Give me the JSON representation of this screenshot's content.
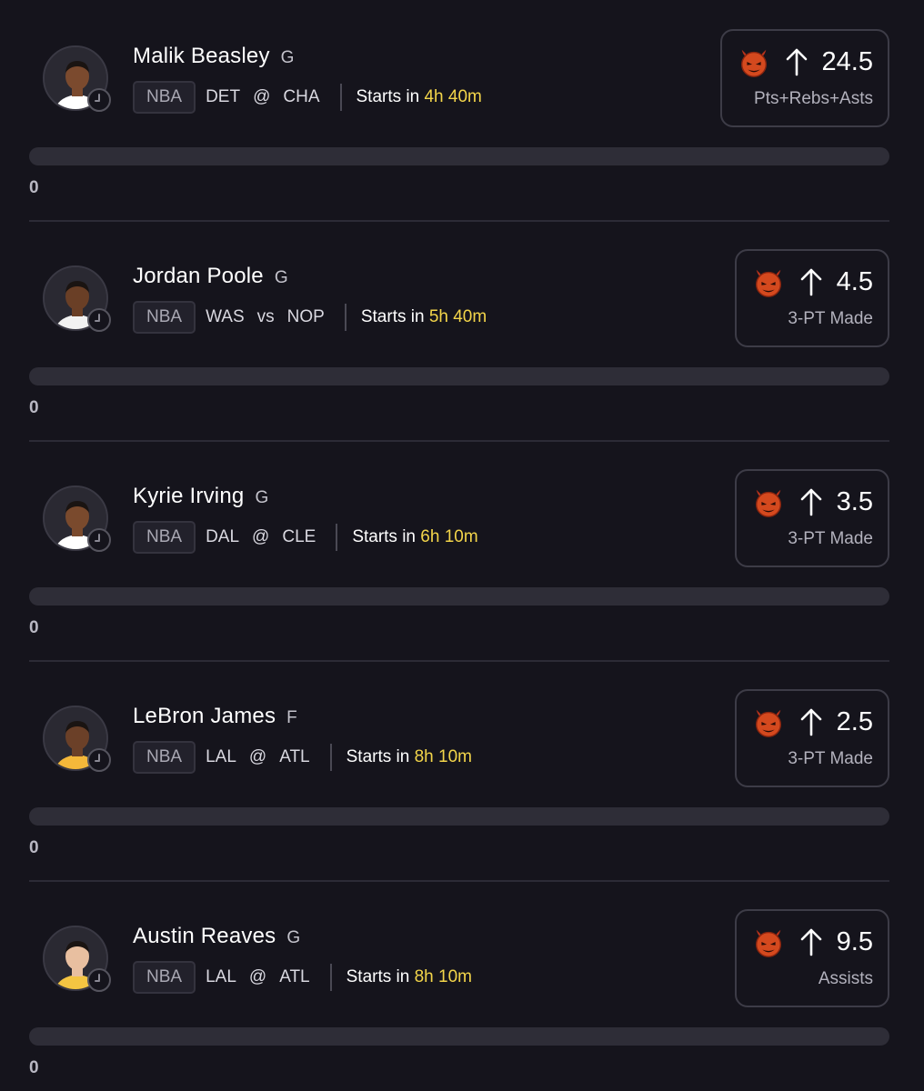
{
  "colors": {
    "background": "#15141c",
    "accent_time": "#f3d54a",
    "track": "#2e2d37",
    "devil": "#d43a1e"
  },
  "icons": {
    "multiplier": "devil-icon",
    "direction": "arrow-up-icon",
    "status": "clock-icon"
  },
  "cards": [
    {
      "name": "Malik Beasley",
      "position": "G",
      "league": "NBA",
      "team": "DET",
      "vs": "@",
      "opponent": "CHA",
      "starts_label": "Starts in",
      "starts_time": "4h 40m",
      "line": "24.5",
      "stat": "Pts+Rebs+Asts",
      "progress_value": "0",
      "progress_fraction": 0,
      "skin": "#7b4a2e",
      "jersey": "#ffffff"
    },
    {
      "name": "Jordan Poole",
      "position": "G",
      "league": "NBA",
      "team": "WAS",
      "vs": "vs",
      "opponent": "NOP",
      "starts_label": "Starts in",
      "starts_time": "5h 40m",
      "line": "4.5",
      "stat": "3-PT Made",
      "progress_value": "0",
      "progress_fraction": 0,
      "skin": "#6a3f26",
      "jersey": "#f2f2f2"
    },
    {
      "name": "Kyrie Irving",
      "position": "G",
      "league": "NBA",
      "team": "DAL",
      "vs": "@",
      "opponent": "CLE",
      "starts_label": "Starts in",
      "starts_time": "6h 10m",
      "line": "3.5",
      "stat": "3-PT Made",
      "progress_value": "0",
      "progress_fraction": 0,
      "skin": "#7a4a2d",
      "jersey": "#ffffff"
    },
    {
      "name": "LeBron James",
      "position": "F",
      "league": "NBA",
      "team": "LAL",
      "vs": "@",
      "opponent": "ATL",
      "starts_label": "Starts in",
      "starts_time": "8h 10m",
      "line": "2.5",
      "stat": "3-PT Made",
      "progress_value": "0",
      "progress_fraction": 0,
      "skin": "#6b4028",
      "jersey": "#f4b83a"
    },
    {
      "name": "Austin Reaves",
      "position": "G",
      "league": "NBA",
      "team": "LAL",
      "vs": "@",
      "opponent": "ATL",
      "starts_label": "Starts in",
      "starts_time": "8h 10m",
      "line": "9.5",
      "stat": "Assists",
      "progress_value": "0",
      "progress_fraction": 0,
      "skin": "#e8bfa0",
      "jersey": "#f4c542"
    }
  ]
}
